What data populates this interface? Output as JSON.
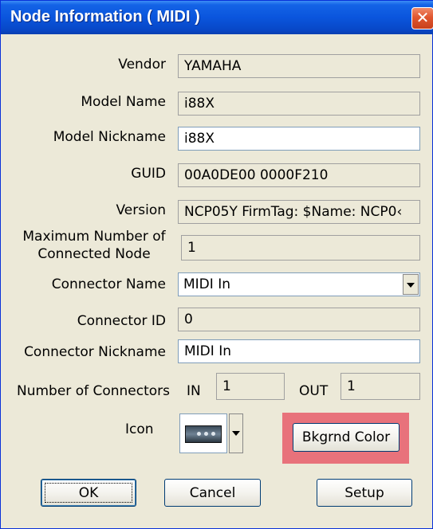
{
  "window": {
    "title": "Node Information ( MIDI )",
    "close_glyph": "✕",
    "accent_color": "#0a55dd",
    "highlight_color": "#e8727b"
  },
  "fields": {
    "vendor": {
      "label": "Vendor",
      "value": "YAMAHA"
    },
    "model_name": {
      "label": "Model Name",
      "value": "i88X"
    },
    "model_nickname": {
      "label": "Model Nickname",
      "value": "i88X"
    },
    "guid": {
      "label": "GUID",
      "value": "00A0DE00 0000F210"
    },
    "version": {
      "label": "Version",
      "value": "NCP05Y FirmTag: $Name: NCP0‹"
    },
    "max_connected": {
      "label_line1": "Maximum Number of",
      "label_line2": "Connected Node",
      "value": "1"
    },
    "connector_name": {
      "label": "Connector Name",
      "value": "MIDI In"
    },
    "connector_id": {
      "label": "Connector ID",
      "value": "0"
    },
    "connector_nickname": {
      "label": "Connector Nickname",
      "value": "MIDI In"
    },
    "num_connectors": {
      "label": "Number of Connectors",
      "in_label": "IN",
      "in_value": "1",
      "out_label": "OUT",
      "out_value": "1"
    },
    "icon": {
      "label": "Icon",
      "icon_name": "midi-device-icon"
    }
  },
  "buttons": {
    "bkgrnd_color": "Bkgrnd Color",
    "ok": "OK",
    "cancel": "Cancel",
    "setup": "Setup"
  }
}
